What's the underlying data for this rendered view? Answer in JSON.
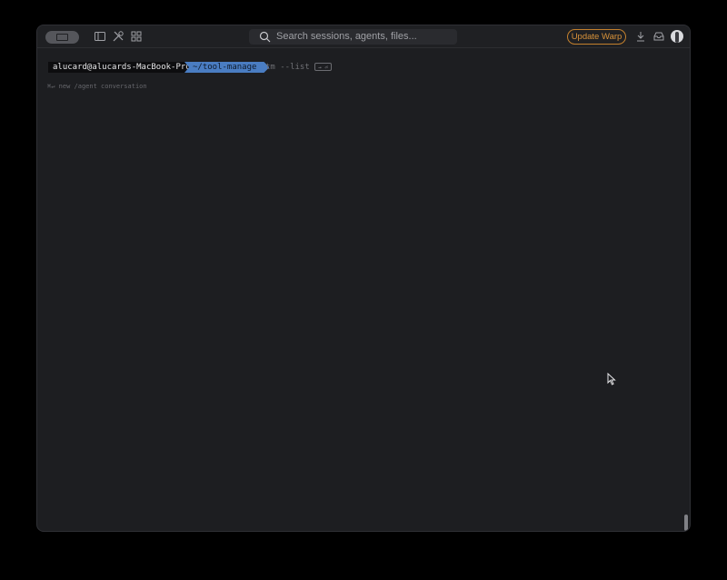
{
  "titlebar": {
    "toggle_icon": "sidebar-toggle-icon",
    "left_icons": [
      "panel-icon",
      "tools-icon",
      "grid-icon"
    ],
    "search": {
      "placeholder": "Search sessions, agents, files...",
      "icon": "search-icon"
    },
    "update_button": "Update Warp",
    "right_icons": [
      "download-icon",
      "inbox-icon",
      "avatar"
    ]
  },
  "terminal": {
    "prompt_user": "alucard@alucards-MacBook-Pro",
    "prompt_path": "~/tool-manage",
    "command": "tm --list",
    "enter_hint": "→ ⏎",
    "hint_keys": "⌘↵",
    "hint_text": "new /agent conversation"
  },
  "colors": {
    "background": "#1d1e21",
    "accent_path": "#4a7dc2",
    "update_orange": "#d8923a"
  }
}
